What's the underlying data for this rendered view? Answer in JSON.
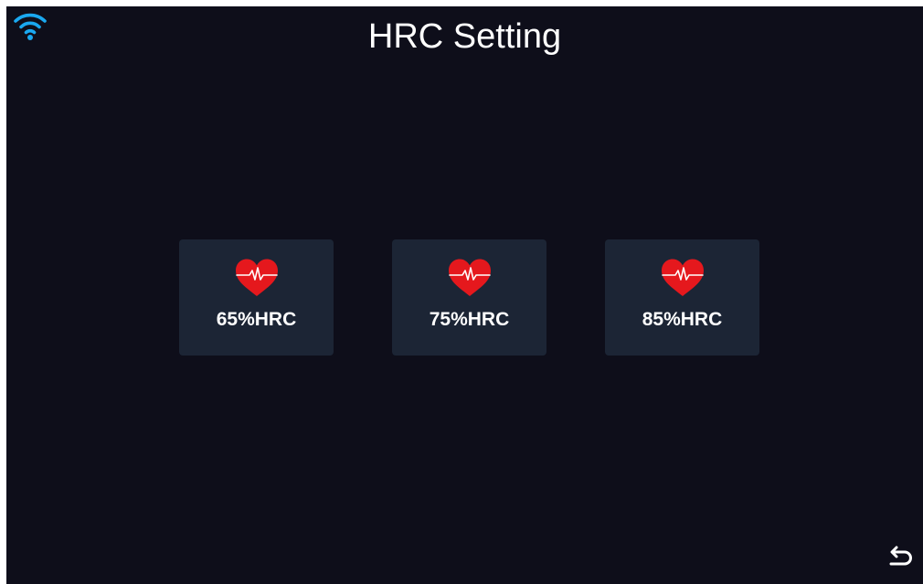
{
  "status_bar": {
    "wifi_icon": "wifi-icon",
    "wifi_color": "#1aa8f0"
  },
  "header": {
    "title": "HRC Setting"
  },
  "options": [
    {
      "label": "65%HRC",
      "icon": "heart-pulse-icon"
    },
    {
      "label": "75%HRC",
      "icon": "heart-pulse-icon"
    },
    {
      "label": "85%HRC",
      "icon": "heart-pulse-icon"
    }
  ],
  "footer": {
    "back_icon": "back-arrow-icon"
  },
  "colors": {
    "background": "#0e0e1a",
    "card": "#1c2535",
    "heart": "#e5181d",
    "text": "#ffffff",
    "accent": "#1aa8f0"
  }
}
